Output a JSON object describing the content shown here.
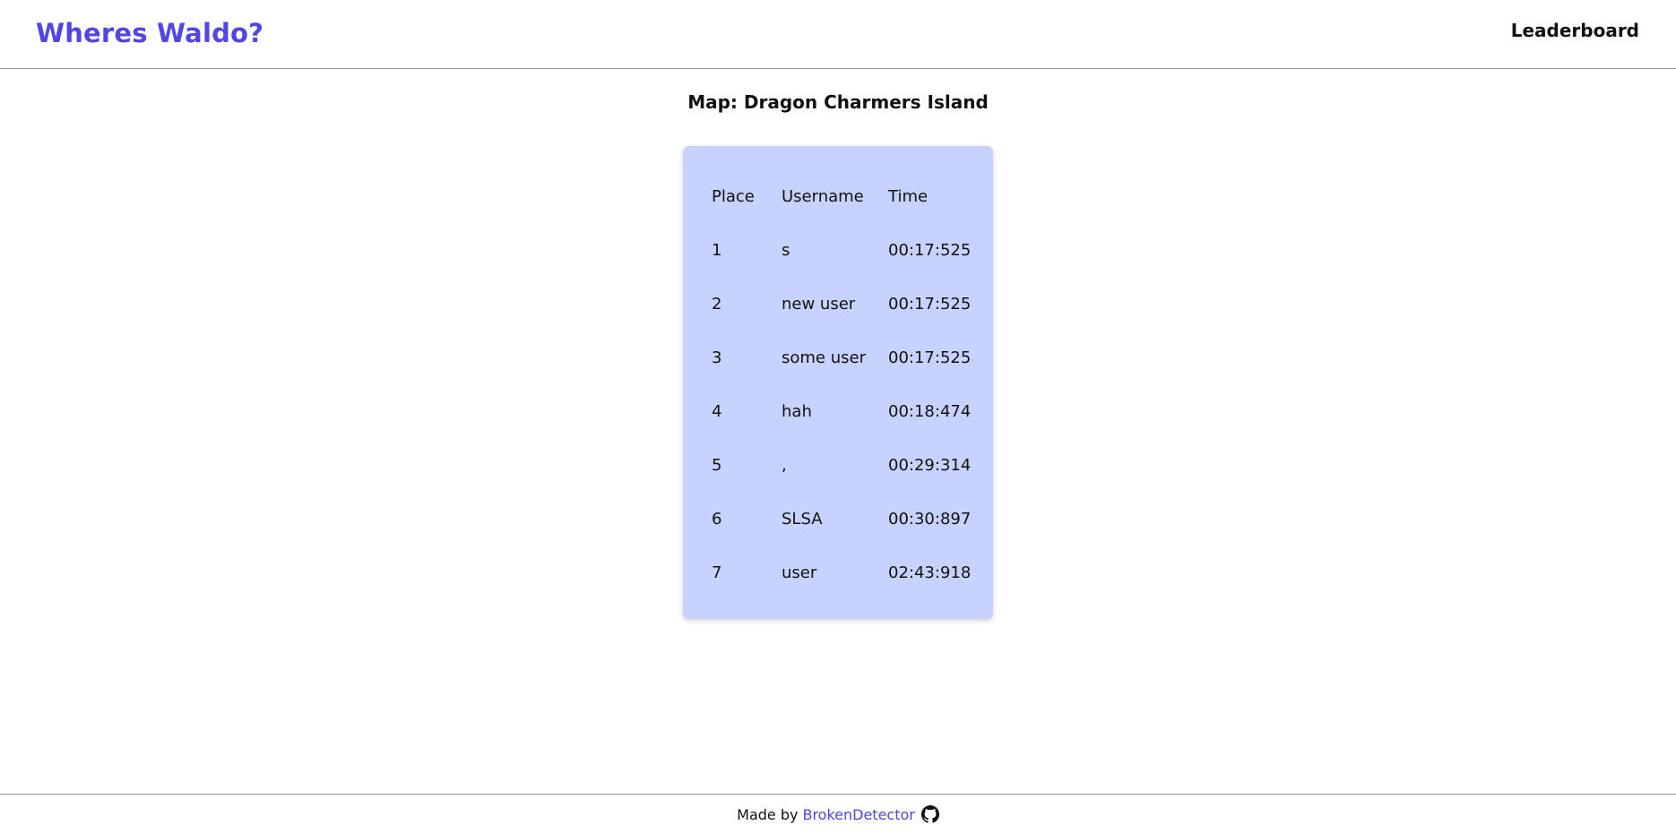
{
  "header": {
    "brand": "Wheres Waldo?",
    "nav_leaderboard": "Leaderboard"
  },
  "main": {
    "map_title": "Map: Dragon Charmers Island",
    "leaderboard": {
      "columns": [
        "Place",
        "Username",
        "Time"
      ],
      "rows": [
        {
          "place": "1",
          "username": "s",
          "time": "00:17:525"
        },
        {
          "place": "2",
          "username": "new user",
          "time": "00:17:525"
        },
        {
          "place": "3",
          "username": "some user",
          "time": "00:17:525"
        },
        {
          "place": "4",
          "username": "hah",
          "time": "00:18:474"
        },
        {
          "place": "5",
          "username": ",",
          "time": "00:29:314"
        },
        {
          "place": "6",
          "username": "SLSA",
          "time": "00:30:897"
        },
        {
          "place": "7",
          "username": "user",
          "time": "02:43:918"
        }
      ]
    }
  },
  "footer": {
    "made_by": "Made by",
    "author": "BrokenDetector",
    "icon": "github-icon"
  },
  "colors": {
    "accent": "#4f46e5",
    "table_bg": "#c7d2fe",
    "divider": "#9a9a9a"
  }
}
